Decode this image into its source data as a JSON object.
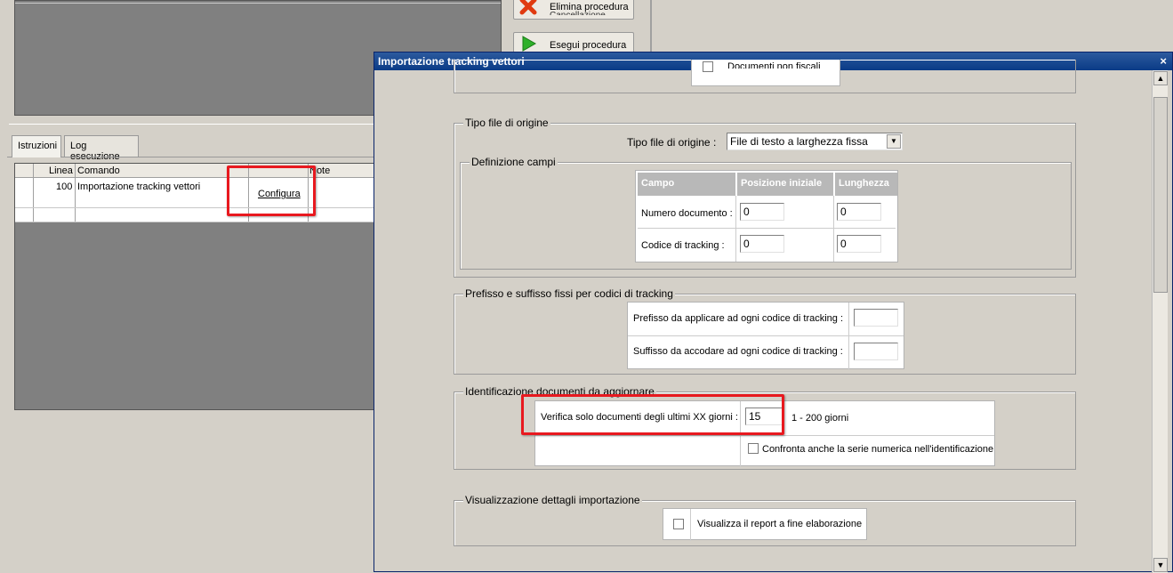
{
  "bg": {
    "buttons": {
      "delete_label": "Elimina procedura",
      "delete_sub": "Cancellazione",
      "run_label": "Esegui procedura"
    },
    "tabs": [
      "Istruzioni",
      "Log esecuzione"
    ],
    "grid": {
      "columns": [
        "Linea",
        "Comando",
        "Note"
      ],
      "rows": [
        {
          "line": "100",
          "command": "Importazione tracking vettori",
          "action": "Configura"
        }
      ]
    }
  },
  "dialog": {
    "title": "Importazione tracking vettori",
    "close_glyph": "×",
    "top_partial": {
      "checkbox_label": "Documenti non fiscali"
    },
    "tipo_file": {
      "legend": "Tipo file di origine",
      "label": "Tipo file di origine :",
      "selected": "File di testo a larghezza fissa"
    },
    "definizione": {
      "legend": "Definizione campi",
      "headers": [
        "Campo",
        "Posizione iniziale",
        "Lunghezza"
      ],
      "rows": [
        {
          "campo": "Numero documento :",
          "posizione": "0",
          "lunghezza": "0"
        },
        {
          "campo": "Codice di tracking :",
          "posizione": "0",
          "lunghezza": "0"
        }
      ]
    },
    "prefisso": {
      "legend": "Prefisso e suffisso fissi per codici di tracking",
      "prefisso_label": "Prefisso da applicare ad ogni codice di tracking :",
      "prefisso_value": "",
      "suffisso_label": "Suffisso da accodare ad ogni codice di tracking :",
      "suffisso_value": ""
    },
    "identificazione": {
      "legend": "Identificazione documenti da aggiornare",
      "verifica_label": "Verifica solo documenti degli ultimi XX giorni :",
      "verifica_value": "15",
      "range_hint": "1 - 200 giorni",
      "confronta_label": "Confronta anche la serie numerica nell'identificazione"
    },
    "visualizzazione": {
      "legend": "Visualizzazione dettagli importazione",
      "report_label": "Visualizza il report a fine elaborazione"
    }
  }
}
